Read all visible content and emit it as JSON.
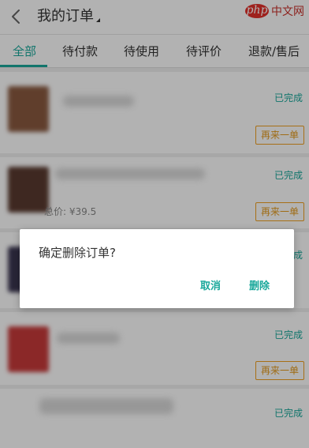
{
  "header": {
    "title": "我的订单",
    "back_icon": "chevron-left-icon"
  },
  "watermark": {
    "badge": "php",
    "text": "中文网"
  },
  "tabs": [
    {
      "label": "全部"
    },
    {
      "label": "待付款"
    },
    {
      "label": "待使用"
    },
    {
      "label": "待评价"
    },
    {
      "label": "退款/售后"
    }
  ],
  "orders": [
    {
      "status": "已完成",
      "reorder_label": "再来一单",
      "total": ""
    },
    {
      "status": "已完成",
      "reorder_label": "再来一单",
      "total": "总价: ¥39.5"
    },
    {
      "status": "已完成",
      "reorder_label": "",
      "total": ""
    },
    {
      "status": "已完成",
      "reorder_label": "再来一单",
      "total": ""
    },
    {
      "status": "已完成",
      "reorder_label": "",
      "total": ""
    }
  ],
  "dialog": {
    "message": "确定删除订单?",
    "cancel_label": "取消",
    "delete_label": "删除"
  },
  "colors": {
    "accent": "#1aa89b",
    "reorder": "#e49a1c",
    "overlay": "rgba(0,0,0,0.30)"
  }
}
